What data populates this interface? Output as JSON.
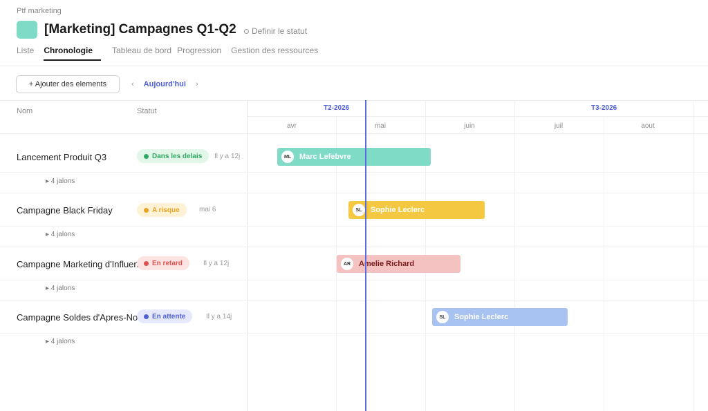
{
  "breadcrumb": "Ptf marketing",
  "header": {
    "title": "[Marketing] Campagnes Q1-Q2",
    "status_link": "Definir le statut",
    "icon_color": "#7fdac6"
  },
  "tabs": [
    {
      "label": "Liste",
      "active": false
    },
    {
      "label": "Chronologie",
      "active": true
    },
    {
      "label": "Tableau de bord",
      "active": false
    },
    {
      "label": "Progression",
      "active": false
    },
    {
      "label": "Gestion des ressources",
      "active": false
    }
  ],
  "toolbar": {
    "add_label": "+ Ajouter des elements",
    "prev_icon": "chevron-left-icon",
    "today_label": "Aujourd'hui",
    "next_icon": "chevron-right-icon"
  },
  "columns": {
    "name": "Nom",
    "status": "Statut"
  },
  "timeline": {
    "quarters": [
      "T2-2026",
      "T3-2026"
    ],
    "months": [
      "avr",
      "mai",
      "juin",
      "juil",
      "aout"
    ]
  },
  "rows": [
    {
      "name": "Lancement Produit Q3",
      "status": "Dans les delais",
      "status_color": "#2faa62",
      "status_bg": "#e3f6ea",
      "updated": "Il y a 12j",
      "milestones": "▸ 4 jalons",
      "owner": "Marc Lefebvre",
      "initials": "ML",
      "bar_color": "#7fdac6",
      "bar_text_color": "#ffffff"
    },
    {
      "name": "Campagne Black Friday",
      "status": "A risque",
      "status_color": "#e9a422",
      "status_bg": "#fdf1d6",
      "updated": "mai 6",
      "milestones": "▸ 4 jalons",
      "owner": "Sophie Leclerc",
      "initials": "SL",
      "bar_color": "#f5c842",
      "bar_text_color": "#ffffff"
    },
    {
      "name": "Campagne Marketing d'Influence",
      "status": "En retard",
      "status_color": "#e0524f",
      "status_bg": "#fce4e3",
      "updated": "Il y a 12j",
      "milestones": "▸ 4 jalons",
      "owner": "Amelie Richard",
      "initials": "AR",
      "bar_color": "#f4c2c0",
      "bar_text_color": "#7a1c1c"
    },
    {
      "name": "Campagne Soldes d'Apres-Noel",
      "status": "En attente",
      "status_color": "#4f5fd5",
      "status_bg": "#e6e9fb",
      "updated": "Il y a 14j",
      "milestones": "▸ 4 jalons",
      "owner": "Sophie Leclerc",
      "initials": "SL",
      "bar_color": "#a8c3f2",
      "bar_text_color": "#ffffff"
    }
  ]
}
